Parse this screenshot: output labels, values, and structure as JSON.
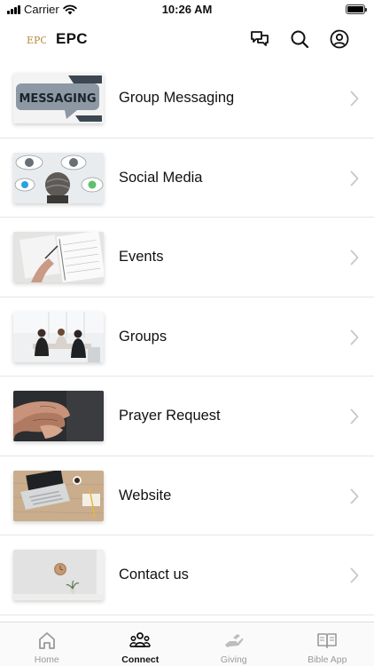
{
  "status_bar": {
    "carrier": "Carrier",
    "time": "10:26 AM"
  },
  "header": {
    "logo_text": "EPC",
    "title": "EPC",
    "icons": [
      "chat-icon",
      "search-icon",
      "profile-icon"
    ]
  },
  "list": {
    "items": [
      {
        "label": "Group Messaging",
        "thumb_text": "MESSAGING"
      },
      {
        "label": "Social Media"
      },
      {
        "label": "Events"
      },
      {
        "label": "Groups"
      },
      {
        "label": "Prayer Request"
      },
      {
        "label": "Website"
      },
      {
        "label": "Contact us"
      }
    ]
  },
  "tab_bar": {
    "tabs": [
      {
        "label": "Home",
        "icon": "home-icon",
        "active": false
      },
      {
        "label": "Connect",
        "icon": "people-icon",
        "active": true
      },
      {
        "label": "Giving",
        "icon": "giving-hand-icon",
        "active": false
      },
      {
        "label": "Bible App",
        "icon": "book-icon",
        "active": false
      }
    ]
  },
  "colors": {
    "active": "#111111",
    "inactive": "#9a9a9a",
    "divider": "#e6e6e6",
    "chevron": "#c7c7cc"
  }
}
